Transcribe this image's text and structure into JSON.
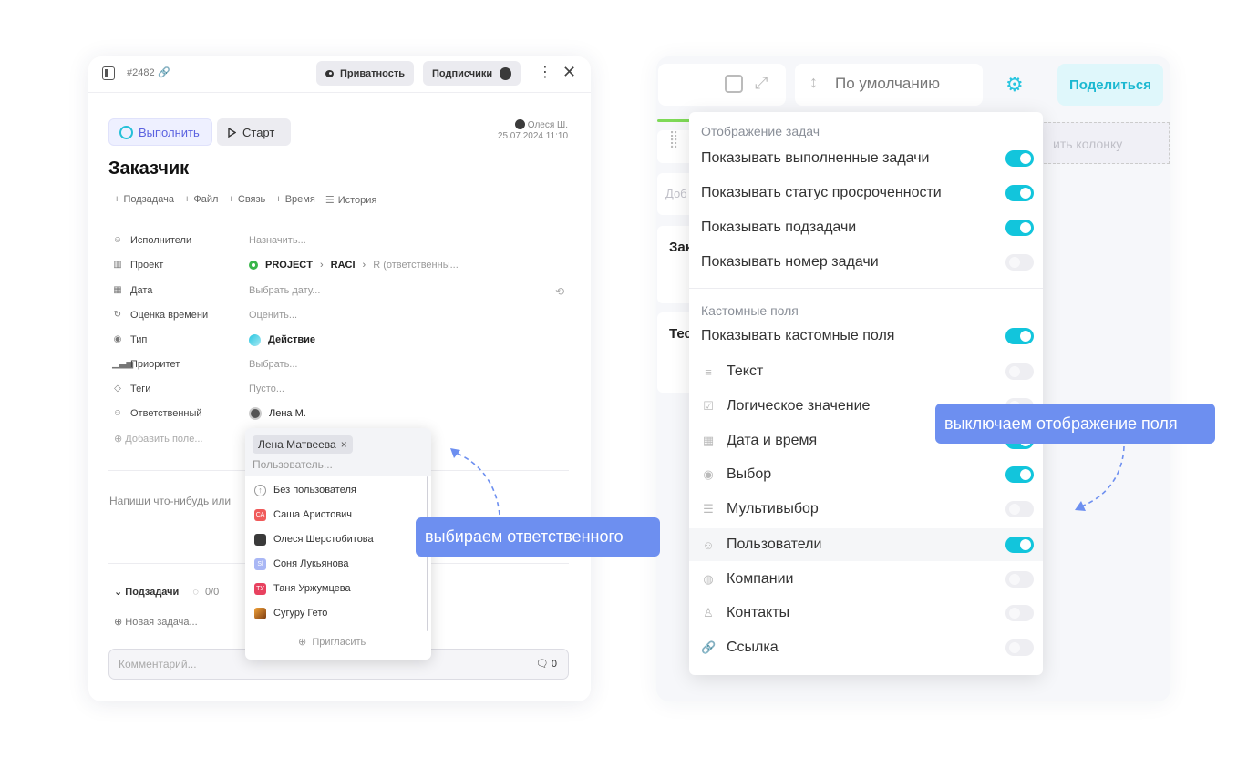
{
  "task": {
    "number": "#2482",
    "privacy_label": "Приватность",
    "subscribers_label": "Подписчики",
    "done_label": "Выполнить",
    "start_label": "Старт",
    "author_name": "Олеся Ш.",
    "author_date": "25.07.2024 11:10",
    "title": "Заказчик",
    "actions": [
      "Подзадача",
      "Файл",
      "Связь",
      "Время",
      "История"
    ],
    "fields": [
      {
        "label": "Исполнители",
        "value": "Назначить..."
      },
      {
        "label": "Проект",
        "project": "PROJECT",
        "board": "RACI",
        "column": "R (ответственны..."
      },
      {
        "label": "Дата",
        "value": "Выбрать дату..."
      },
      {
        "label": "Оценка времени",
        "value": "Оценить..."
      },
      {
        "label": "Тип",
        "value": "Действие"
      },
      {
        "label": "Приоритет",
        "value": "Выбрать..."
      },
      {
        "label": "Теги",
        "value": "Пусто..."
      },
      {
        "label": "Ответственный",
        "value": "Лена М."
      }
    ],
    "add_field": "Добавить поле...",
    "write_hint": "Напиши что-нибудь или",
    "subtasks_label": "Подзадачи",
    "subtasks_count": "0/0",
    "new_task": "Новая задача...",
    "comment_placeholder": "Комментарий...",
    "comment_count": "0"
  },
  "dropdown": {
    "selected_chip": "Лена Матвеева",
    "placeholder": "Пользователь...",
    "items": [
      {
        "name": "Без пользователя",
        "avatar": "",
        "color": "#ffffff"
      },
      {
        "name": "Саша Аристович",
        "avatar": "СА",
        "color": "#f05a5a"
      },
      {
        "name": "Олеся Шерстобитова",
        "avatar": "",
        "color": "#3a3a3a"
      },
      {
        "name": "Соня Лукьянова",
        "avatar": "Sl",
        "color": "#a9b7f5"
      },
      {
        "name": "Таня Уржумцева",
        "avatar": "ТУ",
        "color": "#e8415f"
      },
      {
        "name": "Сугуру Гето",
        "avatar": "",
        "color": "#d8862a"
      }
    ],
    "invite_label": "Пригласить"
  },
  "callouts": {
    "left": "выбираем ответственного",
    "right": "выключаем отображение поля"
  },
  "board": {
    "sort_label": "По умолчанию",
    "share_label": "Поделиться",
    "add_column_text": "ить колонку",
    "card_add_text": "Доб",
    "card1_text": "Зак",
    "card2_text": "Тес"
  },
  "settings": {
    "section1_title": "Отображение задач",
    "section1_rows": [
      {
        "label": "Показывать выполненные задачи",
        "on": true
      },
      {
        "label": "Показывать статус просроченности",
        "on": true
      },
      {
        "label": "Показывать подзадачи",
        "on": true
      },
      {
        "label": "Показывать номер задачи",
        "on": false
      }
    ],
    "section2_title": "Кастомные поля",
    "section2_rows": [
      {
        "label": "Показывать кастомные поля",
        "on": true,
        "icon": ""
      },
      {
        "label": "Текст",
        "on": false,
        "icon": "text-icon"
      },
      {
        "label": "Логическое значение",
        "on": false,
        "icon": "checkbox-icon"
      },
      {
        "label": "Дата и время",
        "on": true,
        "icon": "calendar-icon"
      },
      {
        "label": "Выбор",
        "on": true,
        "icon": "select-icon"
      },
      {
        "label": "Мультивыбор",
        "on": false,
        "icon": "multiselect-icon"
      },
      {
        "label": "Пользователи",
        "on": true,
        "icon": "users-icon",
        "highlighted": true
      },
      {
        "label": "Компании",
        "on": false,
        "icon": "company-icon"
      },
      {
        "label": "Контакты",
        "on": false,
        "icon": "contact-icon"
      },
      {
        "label": "Ссылка",
        "on": false,
        "icon": "link-icon"
      }
    ]
  },
  "colors": {
    "accent_cyan": "#12c5dc",
    "callout_blue": "#6d8ff0",
    "done_purple": "#5b62e0"
  }
}
